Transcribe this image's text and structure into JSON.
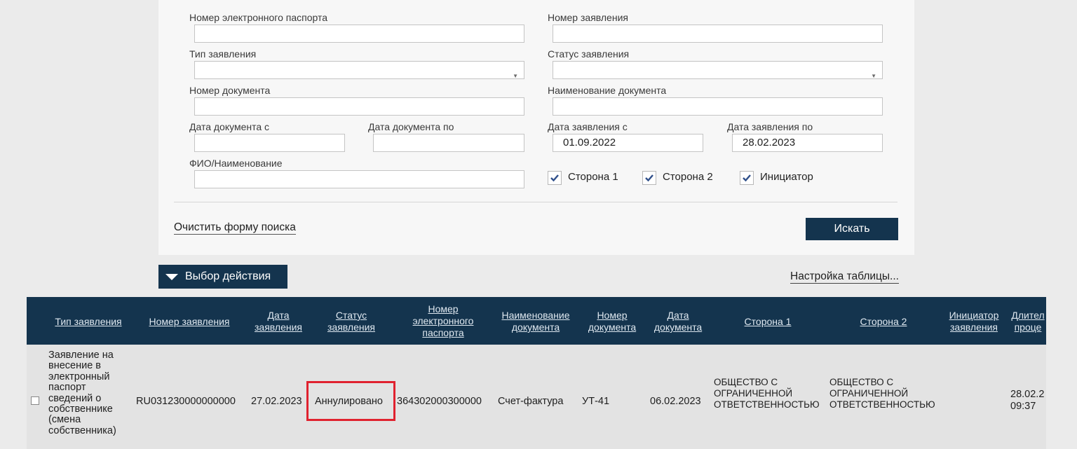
{
  "form": {
    "passport_number_label": "Номер электронного паспорта",
    "passport_number_value": "",
    "application_number_label": "Номер заявления",
    "application_number_value": "",
    "application_type_label": "Тип заявления",
    "application_type_value": "",
    "application_status_label": "Статус заявления",
    "application_status_value": "",
    "document_number_label": "Номер документа",
    "document_number_value": "",
    "document_name_label": "Наименование документа",
    "document_name_value": "",
    "document_date_from_label": "Дата документа с",
    "document_date_from_value": "",
    "document_date_to_label": "Дата документа по",
    "document_date_to_value": "",
    "application_date_from_label": "Дата заявления с",
    "application_date_from_value": "01.09.2022",
    "application_date_to_label": "Дата заявления по",
    "application_date_to_value": "28.02.2023",
    "fio_label": "ФИО/Наименование",
    "fio_value": "",
    "checkboxes": [
      {
        "label": "Сторона 1",
        "checked": true
      },
      {
        "label": "Сторона 2",
        "checked": true
      },
      {
        "label": "Инициатор",
        "checked": true
      }
    ],
    "clear_link": "Очистить форму поиска",
    "search_button": "Искать"
  },
  "toolbar": {
    "action_button": "Выбор действия",
    "table_settings": "Настройка таблицы..."
  },
  "table": {
    "columns": [
      "Тип заявления",
      "Номер заявления",
      "Дата\nзаявления",
      "Статус\nзаявления",
      "Номер\nэлектронного\nпаспорта",
      "Наименование\nдокумента",
      "Номер\nдокумента",
      "Дата\nдокумента",
      "Сторона 1",
      "Сторона 2",
      "Инициатор\nзаявления",
      "Длител\nпроце"
    ],
    "rows": [
      {
        "type": "Заявление на\nвнесение в\nэлектронный\nпаспорт\nсведений о\nсобственнике\n(смена\nсобственника)",
        "number": "RU031230000000000",
        "date": "27.02.2023",
        "status": "Аннулировано",
        "passport_number": "364302000300000",
        "doc_name": "Счет-фактура",
        "doc_number": "УТ-41",
        "doc_date": "06.02.2023",
        "side1": "ОБЩЕСТВО С\nОГРАНИЧЕННОЙ\nОТВЕТСТВЕННОСТЬЮ",
        "side2": "ОБЩЕСТВО С\nОГРАНИЧЕННОЙ\nОТВЕТСТВЕННОСТЬЮ",
        "initiator": "",
        "duration": "28.02.2\n09:37"
      }
    ]
  },
  "colors": {
    "dark_navy": "#14344e",
    "highlight_red": "#e0222f",
    "checkbox_check": "#2f4f8a"
  }
}
